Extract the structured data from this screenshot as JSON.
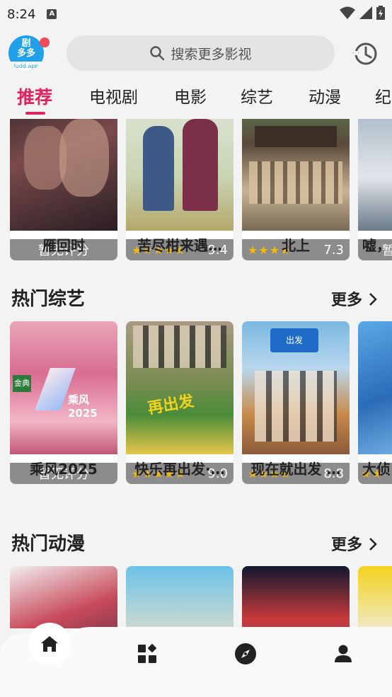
{
  "status": {
    "time": "8:24",
    "a_icon": "A"
  },
  "header": {
    "logo_text": "剧\n多多",
    "logo_sub": "judd.app",
    "search_placeholder": "搜索更多影视"
  },
  "tabs": [
    "推荐",
    "电视剧",
    "电影",
    "综艺",
    "动漫",
    "纪"
  ],
  "rows": {
    "top": [
      {
        "title": "雁回时",
        "rating_text": "暂无评分",
        "rated": false
      },
      {
        "title": "苦尽柑来遇…",
        "rating": "9.4",
        "stars": 5,
        "rated": true
      },
      {
        "title": "北上",
        "rating": "7.3",
        "stars": 4,
        "rated": true
      },
      {
        "title": "嘘，",
        "rating_text": "暂",
        "rated": false
      }
    ],
    "variety": [
      {
        "title": "乘风2025",
        "rating_text": "暂无评分",
        "rated": false
      },
      {
        "title": "快乐再出发·…",
        "rating": "9.0",
        "stars": 5,
        "rated": true
      },
      {
        "title": "现在就出发 …",
        "rating": "8.8",
        "stars": 4,
        "rated": true
      },
      {
        "title": "大侦",
        "rating": "",
        "stars": 2,
        "rated": true
      }
    ]
  },
  "sections": {
    "variety_title": "热门综艺",
    "anime_title": "热门动漫",
    "more": "更多"
  },
  "colors": {
    "accent": "#e0245e",
    "star": "#f5b90a"
  },
  "nav": [
    "home-icon",
    "apps-icon",
    "compass-icon",
    "person-icon"
  ]
}
